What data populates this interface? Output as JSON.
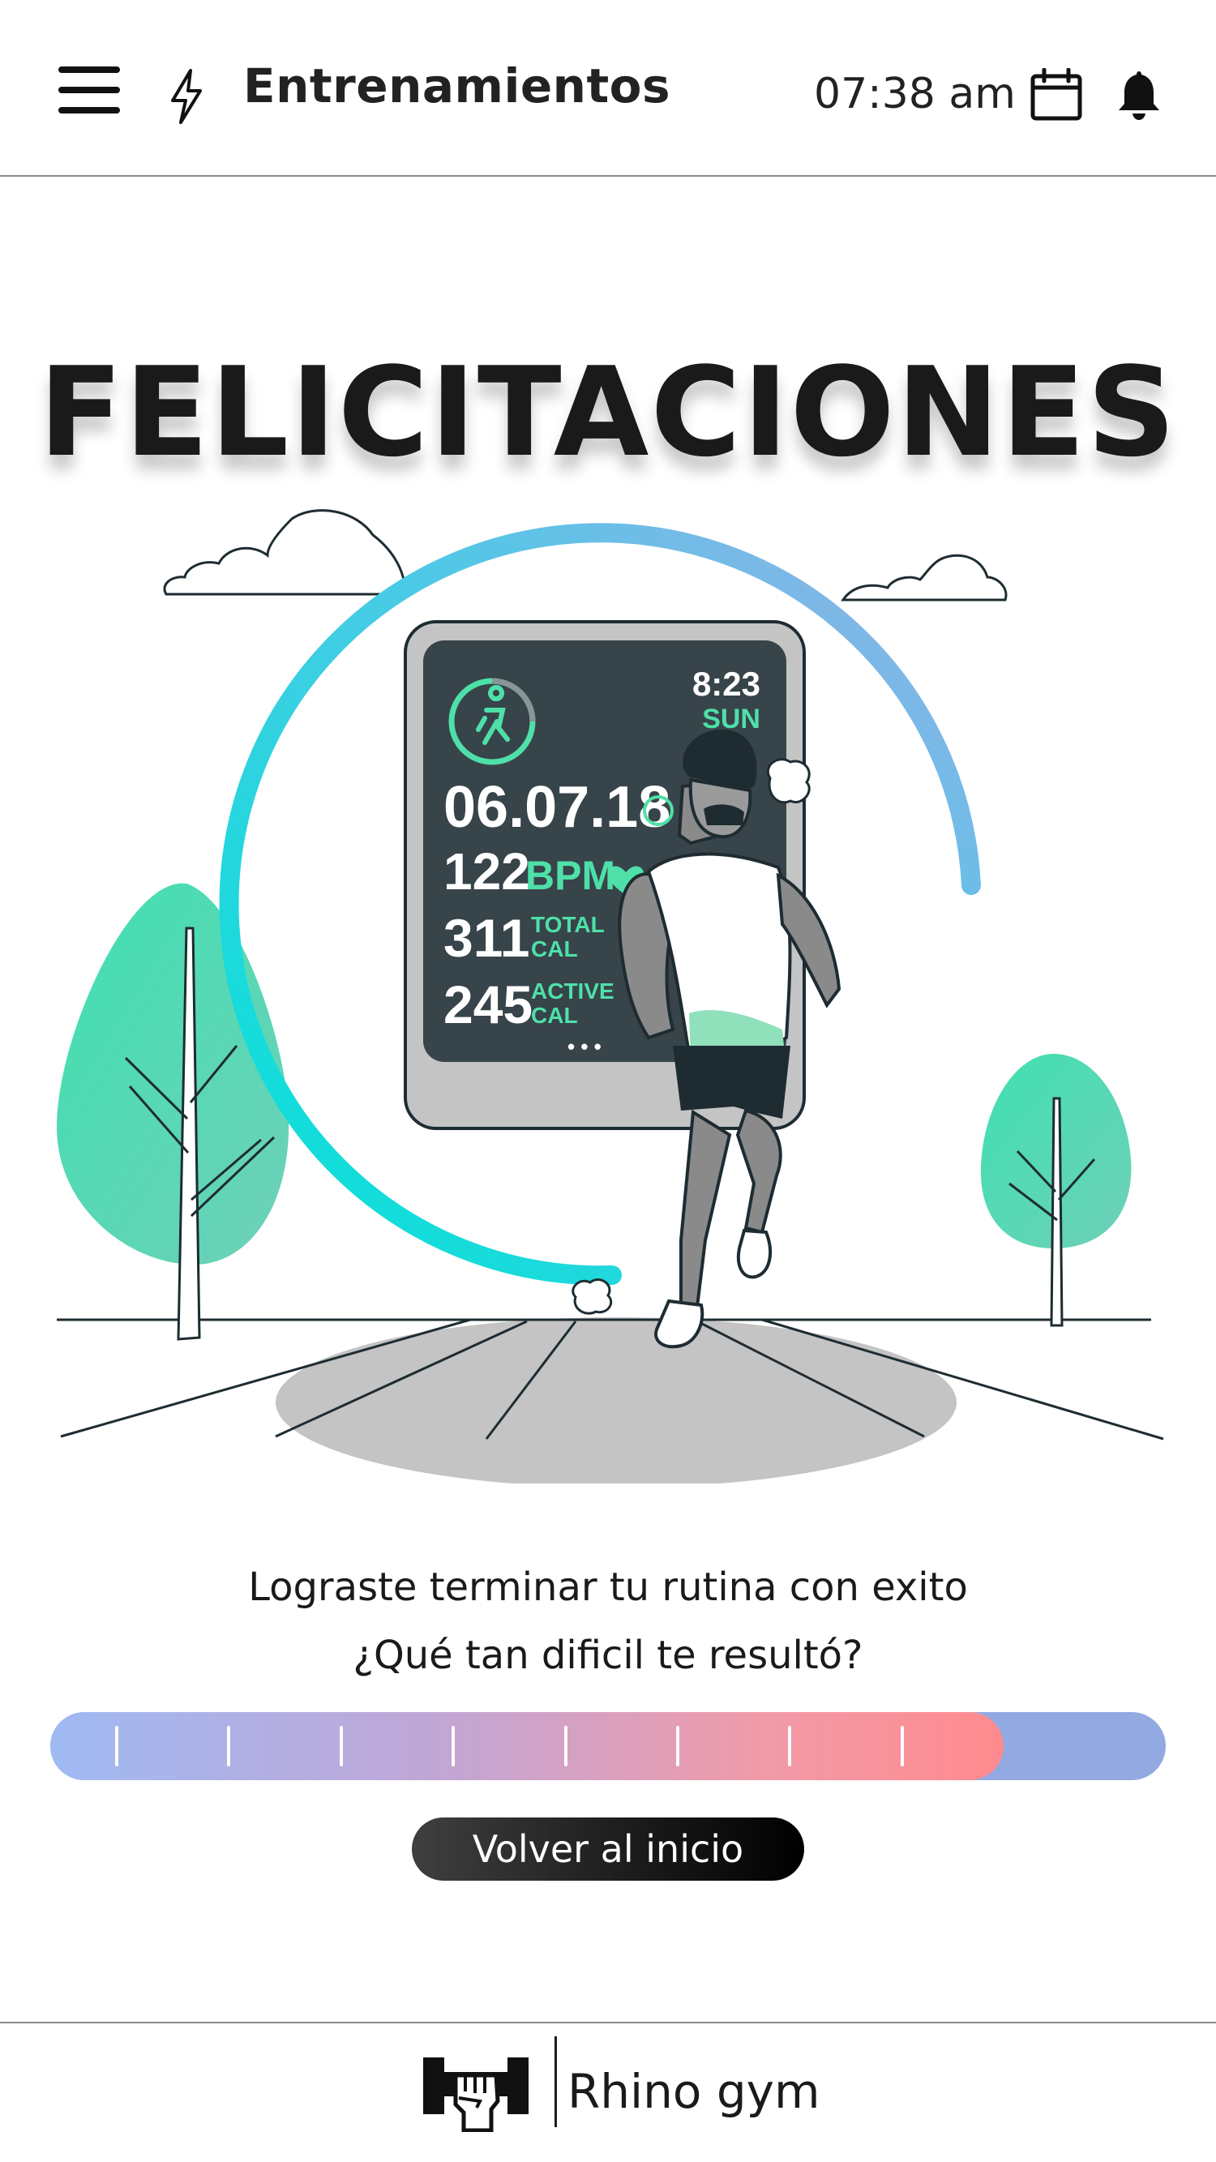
{
  "header": {
    "menu_icon": "hamburger-menu-icon",
    "section_icon": "lightning-bolt-icon",
    "title": "Entrenamientos",
    "time": "07:38 am",
    "calendar_icon": "calendar-icon",
    "notification_icon": "bell-icon"
  },
  "hero": {
    "title": "FELICITACIONES"
  },
  "illustration": {
    "watch": {
      "time": "8:23",
      "day": "SUN",
      "date": "06.07.18",
      "bpm_value": "122",
      "bpm_unit": "BPM",
      "total_value": "311",
      "total_label_1": "TOTAL",
      "total_label_2": "CAL",
      "active_value": "245",
      "active_label_1": "ACTIVE",
      "active_label_2": "CAL",
      "more": "• • •"
    }
  },
  "message": {
    "line1": "Lograste terminar tu rutina con exito",
    "line2": "¿Qué tan dificil te resultó?"
  },
  "difficulty": {
    "selected_fraction": 0.855,
    "ticks": 8
  },
  "actions": {
    "home_label": "Volver al inicio"
  },
  "footer": {
    "logo_icon": "rhino-gym-fist-logo-icon",
    "brand": "Rhino gym"
  },
  "colors": {
    "accent_teal": "#00e0d8",
    "accent_green": "#4ee0a8",
    "watch_screen": "#37444a",
    "slider_track": "#93a9e2",
    "slider_end": "#ff8a8e"
  }
}
